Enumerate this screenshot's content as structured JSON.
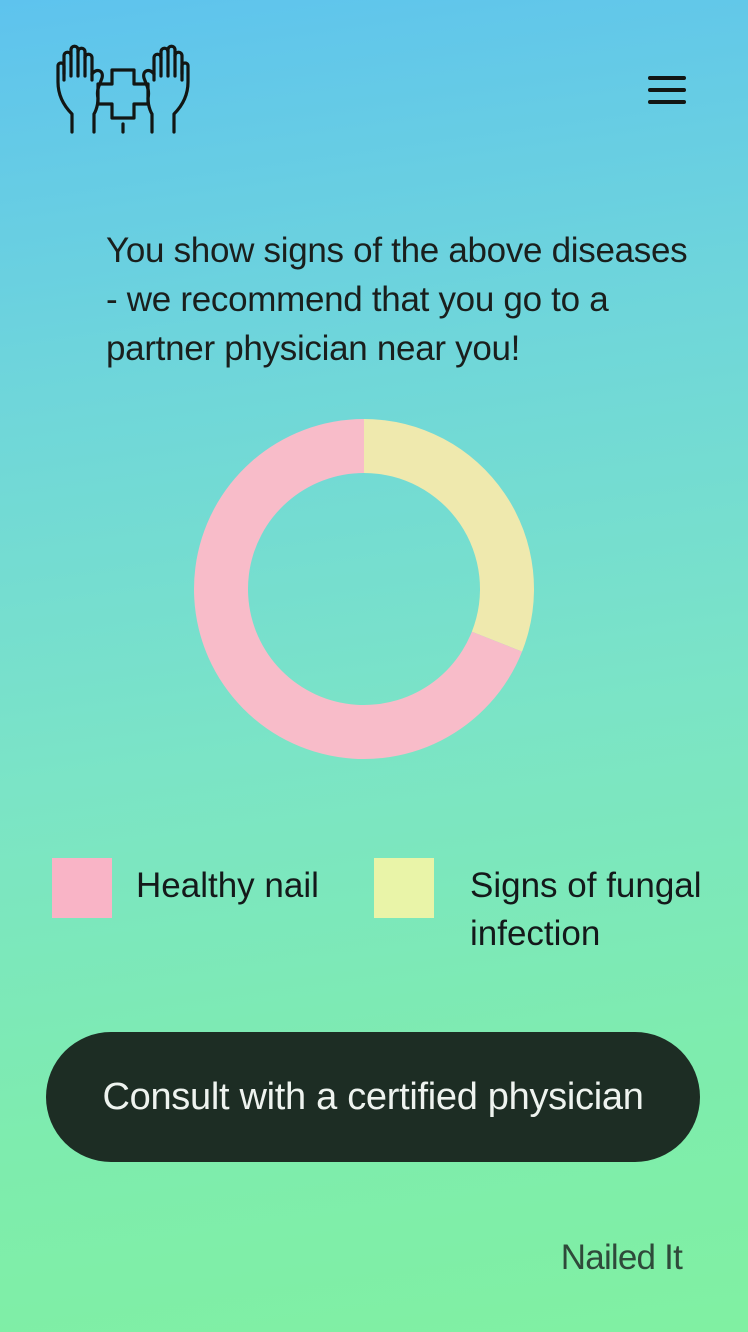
{
  "header": {
    "logo_icon": "hands-with-medical-cross-icon",
    "menu_icon": "hamburger-menu-icon"
  },
  "message": "You show signs of the above diseases - we recommend that you go to a partner physician near you!",
  "chart_data": {
    "type": "pie",
    "variant": "donut",
    "title": "",
    "categories": [
      "Healthy nail",
      "Signs of fungal infection"
    ],
    "values": [
      69,
      31
    ],
    "colors": [
      "#f8bcc9",
      "#efe9ae"
    ],
    "legend_colors": [
      "#f9b4c6",
      "#e9f4a8"
    ],
    "start_angle_deg": 0,
    "direction": "clockwise",
    "order_clockwise_from_top": [
      "Signs of fungal infection",
      "Healthy nail"
    ],
    "legend_position": "bottom"
  },
  "legend": {
    "healthy_label": "Healthy nail",
    "fungal_label": "Signs of fungal infection"
  },
  "cta": {
    "label": "Consult with a certified physician"
  },
  "brand": "Nailed It",
  "colors": {
    "button_bg": "#1d2d24",
    "button_text": "#eef3ef",
    "gradient_top": "#5ec3ee",
    "gradient_bottom": "#80f0a2"
  }
}
